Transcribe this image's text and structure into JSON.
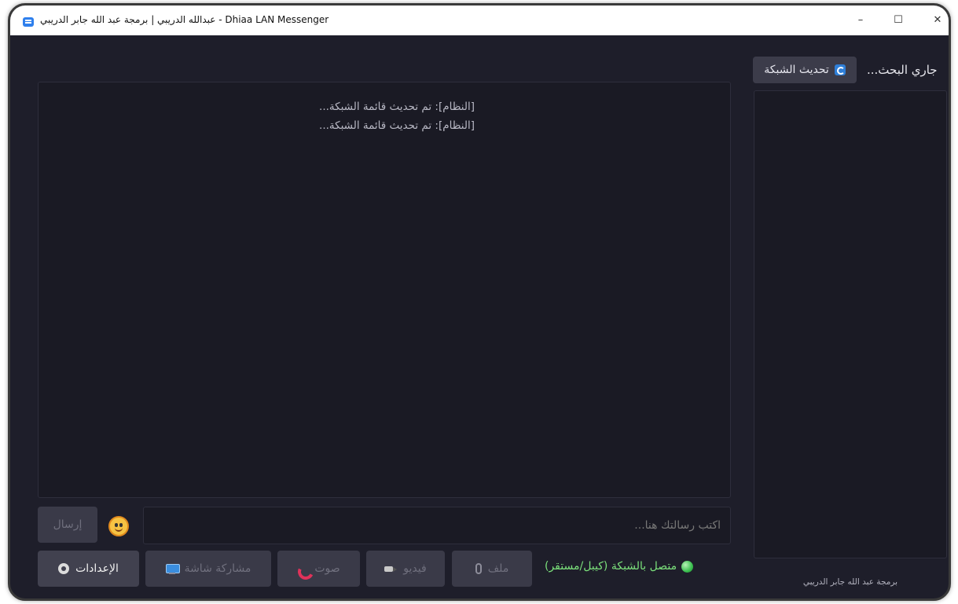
{
  "window": {
    "title": "عبدالله الدريبي | برمجة عبد الله جابر الدريبي - Dhiaa LAN Messenger",
    "minimize_glyph": "–",
    "maximize_glyph": "☐",
    "close_glyph": "✕"
  },
  "sidebar": {
    "search_status": "جاري البحث...",
    "refresh_label": "تحديث الشبكة",
    "refresh_icon": "refresh-icon",
    "credit": "برمجة عبد الله جابر الدريبي"
  },
  "chat": {
    "messages": [
      "[النظام]: تم تحديث قائمة الشبكة...",
      "[النظام]: تم تحديث قائمة الشبكة..."
    ],
    "input_placeholder": "اكتب رسالتك هنا...",
    "send_label": "إرسال",
    "emoji_icon": "emoji-smile-icon"
  },
  "toolbar": {
    "settings_label": "الإعدادات",
    "share_screen_label": "مشاركة شاشة",
    "voice_label": "صوت",
    "video_label": "فيديو",
    "file_label": "ملف"
  },
  "status": {
    "text": "متصل بالشبكة (كيبل/مستقر)",
    "color": "#7be07b"
  },
  "colors": {
    "background": "#1e1e2a",
    "panel": "#1a1a24",
    "button": "#3a3a48",
    "accent_blue": "#2f7fd8"
  }
}
